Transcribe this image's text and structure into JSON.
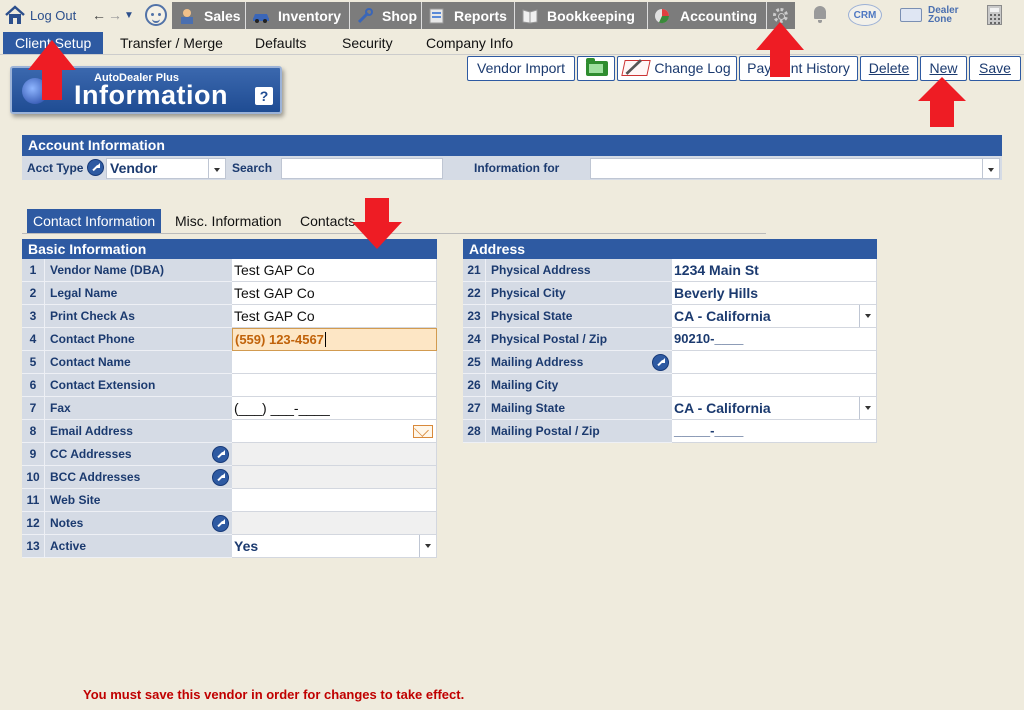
{
  "nav": {
    "logout": "Log Out",
    "modules": [
      "Sales",
      "Inventory",
      "Shop",
      "Reports",
      "Bookkeeping",
      "Accounting"
    ],
    "crm": "CRM",
    "dealer_zone": [
      "Dealer",
      "Zone"
    ]
  },
  "submenu": [
    "Client Setup",
    "Transfer / Merge",
    "Defaults",
    "Security",
    "Company Info"
  ],
  "badge": {
    "small": "AutoDealer Plus",
    "big": "Information",
    "help": "?"
  },
  "toolbar": {
    "vendor_import": "Vendor Import",
    "change_log": "Change Log",
    "payment_history": "Payment History",
    "delete": "Delete",
    "new": "New",
    "save": "Save"
  },
  "account": {
    "header": "Account Information",
    "acct_type_label": "Acct Type",
    "acct_type_value": "Vendor",
    "search_label": "Search",
    "search_value": "",
    "info_for_label": "Information for",
    "info_for_value": ""
  },
  "tabs": [
    "Contact Information",
    "Misc. Information",
    "Contacts"
  ],
  "basic": {
    "header": "Basic Information",
    "rows": [
      {
        "num": "1",
        "label": "Vendor Name (DBA)",
        "value": "Test GAP Co"
      },
      {
        "num": "2",
        "label": "Legal Name",
        "value": "Test GAP Co"
      },
      {
        "num": "3",
        "label": "Print Check As",
        "value": "Test GAP Co"
      },
      {
        "num": "4",
        "label": "Contact Phone",
        "value": "(559) 123-4567"
      },
      {
        "num": "5",
        "label": "Contact Name",
        "value": ""
      },
      {
        "num": "6",
        "label": "Contact Extension",
        "value": ""
      },
      {
        "num": "7",
        "label": "Fax",
        "value": "(___) ___-____"
      },
      {
        "num": "8",
        "label": "Email Address",
        "value": ""
      },
      {
        "num": "9",
        "label": "CC Addresses",
        "value": ""
      },
      {
        "num": "10",
        "label": "BCC Addresses",
        "value": ""
      },
      {
        "num": "11",
        "label": "Web Site",
        "value": ""
      },
      {
        "num": "12",
        "label": "Notes",
        "value": ""
      },
      {
        "num": "13",
        "label": "Active",
        "value": "Yes"
      }
    ]
  },
  "address": {
    "header": "Address",
    "rows": [
      {
        "num": "21",
        "label": "Physical Address",
        "value": "1234 Main St"
      },
      {
        "num": "22",
        "label": "Physical City",
        "value": "Beverly Hills"
      },
      {
        "num": "23",
        "label": "Physical State",
        "value": "CA - California"
      },
      {
        "num": "24",
        "label": "Physical Postal / Zip",
        "value": "90210-____"
      },
      {
        "num": "25",
        "label": "Mailing Address",
        "value": ""
      },
      {
        "num": "26",
        "label": "Mailing City",
        "value": ""
      },
      {
        "num": "27",
        "label": "Mailing State",
        "value": "CA - California"
      },
      {
        "num": "28",
        "label": "Mailing Postal / Zip",
        "value": "_____-____"
      }
    ]
  },
  "notice": "You must save this vendor in order for changes to take effect.",
  "colors": {
    "primary": "#2e5aa2",
    "nav_tab": "#7c7c7c",
    "annotation": "#ee1c24",
    "notice": "#c00000"
  }
}
